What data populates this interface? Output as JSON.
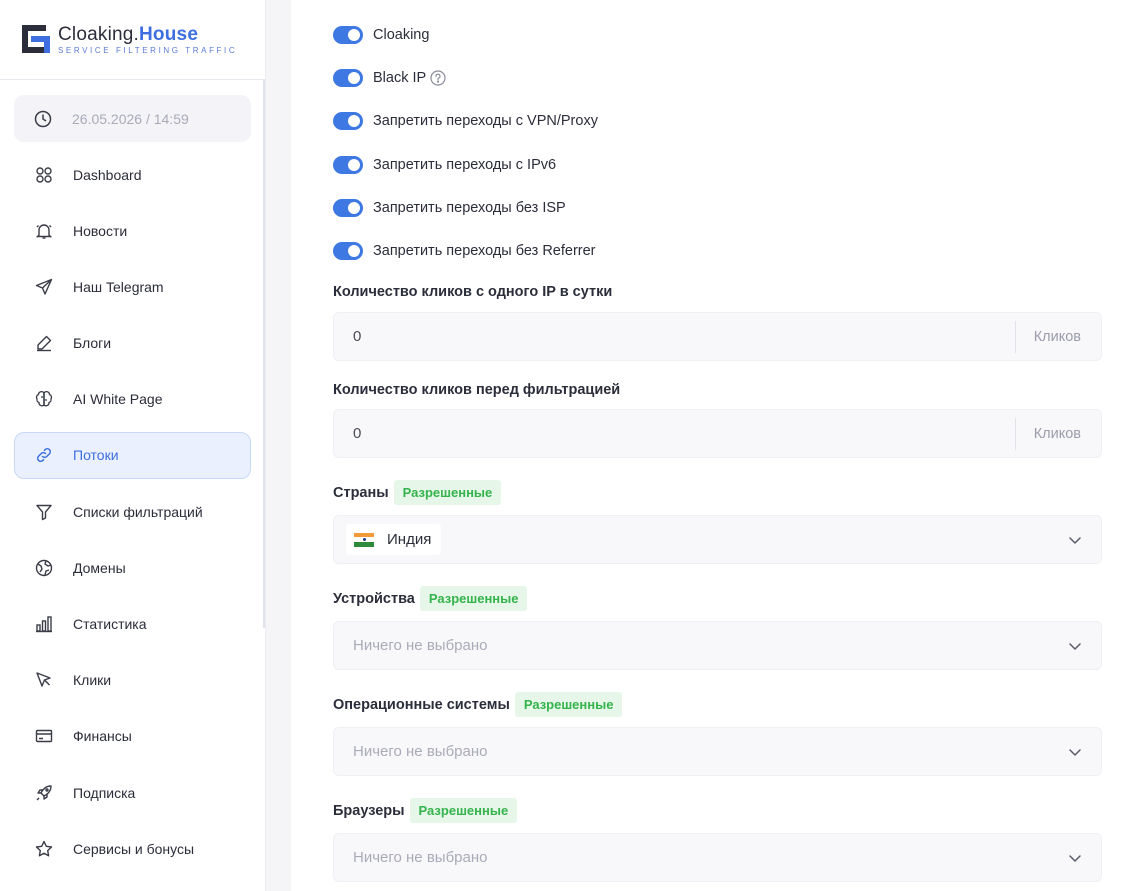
{
  "brand": {
    "name_part1": "Cloaking.",
    "name_part2": "House",
    "tagline": "SERVICE FILTERING TRAFFIC",
    "accent_color": "#3d6fe0"
  },
  "sidebar": {
    "datetime": "26.05.2026 / 14:59",
    "items": [
      {
        "label": "Dashboard",
        "icon": "dashboard-icon"
      },
      {
        "label": "Новости",
        "icon": "bell-icon"
      },
      {
        "label": "Наш Telegram",
        "icon": "telegram-icon"
      },
      {
        "label": "Блоги",
        "icon": "pencil-icon"
      },
      {
        "label": "AI White Page",
        "icon": "brain-icon"
      },
      {
        "label": "Потоки",
        "icon": "link-icon",
        "active": true
      },
      {
        "label": "Списки фильтраций",
        "icon": "filter-icon"
      },
      {
        "label": "Домены",
        "icon": "globe-icon"
      },
      {
        "label": "Статистика",
        "icon": "chart-icon"
      },
      {
        "label": "Клики",
        "icon": "cursor-icon"
      },
      {
        "label": "Финансы",
        "icon": "card-icon"
      },
      {
        "label": "Подписка",
        "icon": "rocket-icon"
      },
      {
        "label": "Сервисы и бонусы",
        "icon": "star-icon"
      }
    ]
  },
  "toggles": [
    {
      "label": "Cloaking",
      "on": true
    },
    {
      "label": "Black IP",
      "on": true,
      "help": true
    },
    {
      "label": "Запретить переходы с VPN/Proxy",
      "on": true
    },
    {
      "label": "Запретить переходы с IPv6",
      "on": true
    },
    {
      "label": "Запретить переходы без ISP",
      "on": true
    },
    {
      "label": "Запретить переходы без Referrer",
      "on": true
    }
  ],
  "clicks_per_ip": {
    "label": "Количество кликов с одного IP в сутки",
    "value": "0",
    "suffix": "Кликов"
  },
  "clicks_before_filter": {
    "label": "Количество кликов перед фильтрацией",
    "value": "0",
    "suffix": "Кликов"
  },
  "countries": {
    "label": "Страны",
    "badge": "Разрешенные",
    "selected": "Индия"
  },
  "devices": {
    "label": "Устройства",
    "badge": "Разрешенные",
    "placeholder": "Ничего не выбрано"
  },
  "os": {
    "label": "Операционные системы",
    "badge": "Разрешенные",
    "placeholder": "Ничего не выбрано"
  },
  "browsers": {
    "label": "Браузеры",
    "badge": "Разрешенные",
    "placeholder": "Ничего не выбрано"
  }
}
